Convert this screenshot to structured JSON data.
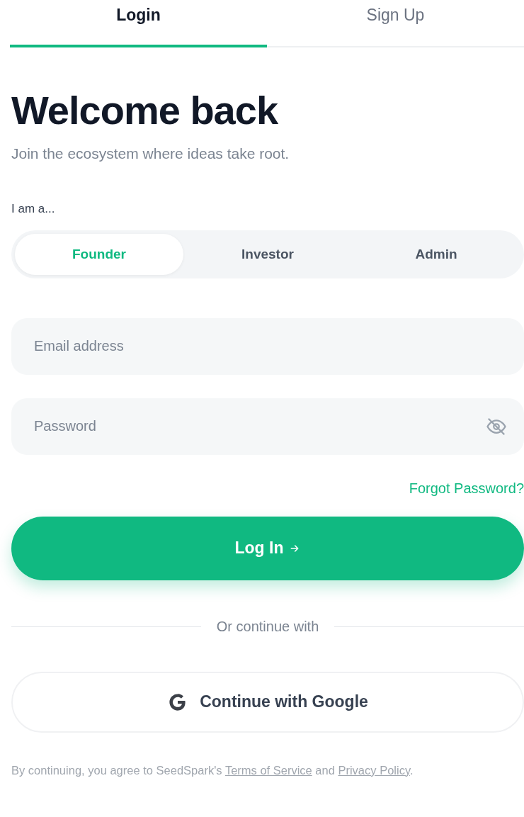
{
  "tabs": [
    {
      "label": "Login",
      "selected": true
    },
    {
      "label": "Sign Up",
      "selected": false
    }
  ],
  "heading": "Welcome back",
  "subtitle": "Join the ecosystem where ideas take root.",
  "role_label": "I am a...",
  "roles": [
    {
      "label": "Founder",
      "selected": true
    },
    {
      "label": "Investor",
      "selected": false
    },
    {
      "label": "Admin",
      "selected": false
    }
  ],
  "fields": [
    {
      "kind": "email",
      "placeholder": "Email address"
    },
    {
      "kind": "password",
      "placeholder": "Password"
    }
  ],
  "forgot_link": "Forgot Password?",
  "login_button": "Log In",
  "divider_text": "Or continue with",
  "google_button": "Continue with Google",
  "footer": {
    "before": "By continuing, you agree to SeedSpark's ",
    "terms_link": "Terms of Service",
    "middle": " and ",
    "privacy_link": "Privacy Policy",
    "after": "."
  }
}
